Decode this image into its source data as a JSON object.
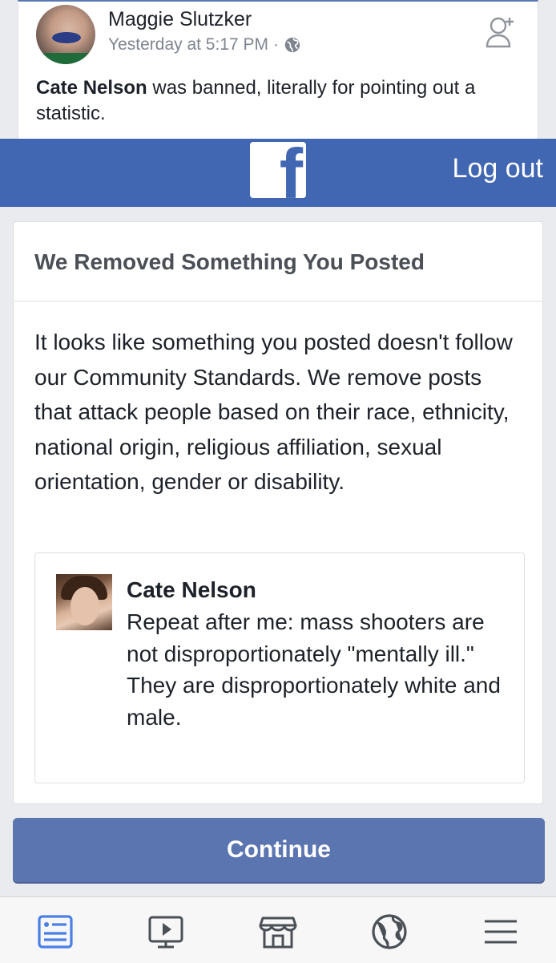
{
  "post": {
    "author": "Maggie Slutzker",
    "timestamp": "Yesterday at 5:17 PM",
    "separator": "·",
    "privacy_icon": "globe-icon",
    "add_friend_icon": "add-friend-icon",
    "mention": "Cate Nelson",
    "text": " was banned, literally for pointing out a statistic."
  },
  "header": {
    "logo_glyph": "f",
    "logout_label": "Log out"
  },
  "notice": {
    "title": "We Removed Something You Posted",
    "body": "It looks like something you posted doesn't follow our Community Standards. We remove posts that attack people based on their race, ethnicity, national origin, religious affiliation, sexual orientation, gender or disability.",
    "quoted_post": {
      "author": "Cate Nelson",
      "text": "Repeat after me: mass shooters are not disproportionately \"mentally ill.\" They are disproportionately white and male."
    },
    "continue_label": "Continue"
  },
  "tabbar": {
    "items": [
      {
        "icon": "news-feed-icon",
        "active": true
      },
      {
        "icon": "watch-video-icon",
        "active": false
      },
      {
        "icon": "marketplace-icon",
        "active": false
      },
      {
        "icon": "globe-notifications-icon",
        "active": false
      },
      {
        "icon": "menu-icon",
        "active": false
      }
    ]
  },
  "colors": {
    "brand_blue": "#4267b2",
    "button_blue": "#5b75b0",
    "active_tab": "#4a80e8",
    "inactive_tab": "#4b4f56",
    "background": "#e9ebee"
  }
}
